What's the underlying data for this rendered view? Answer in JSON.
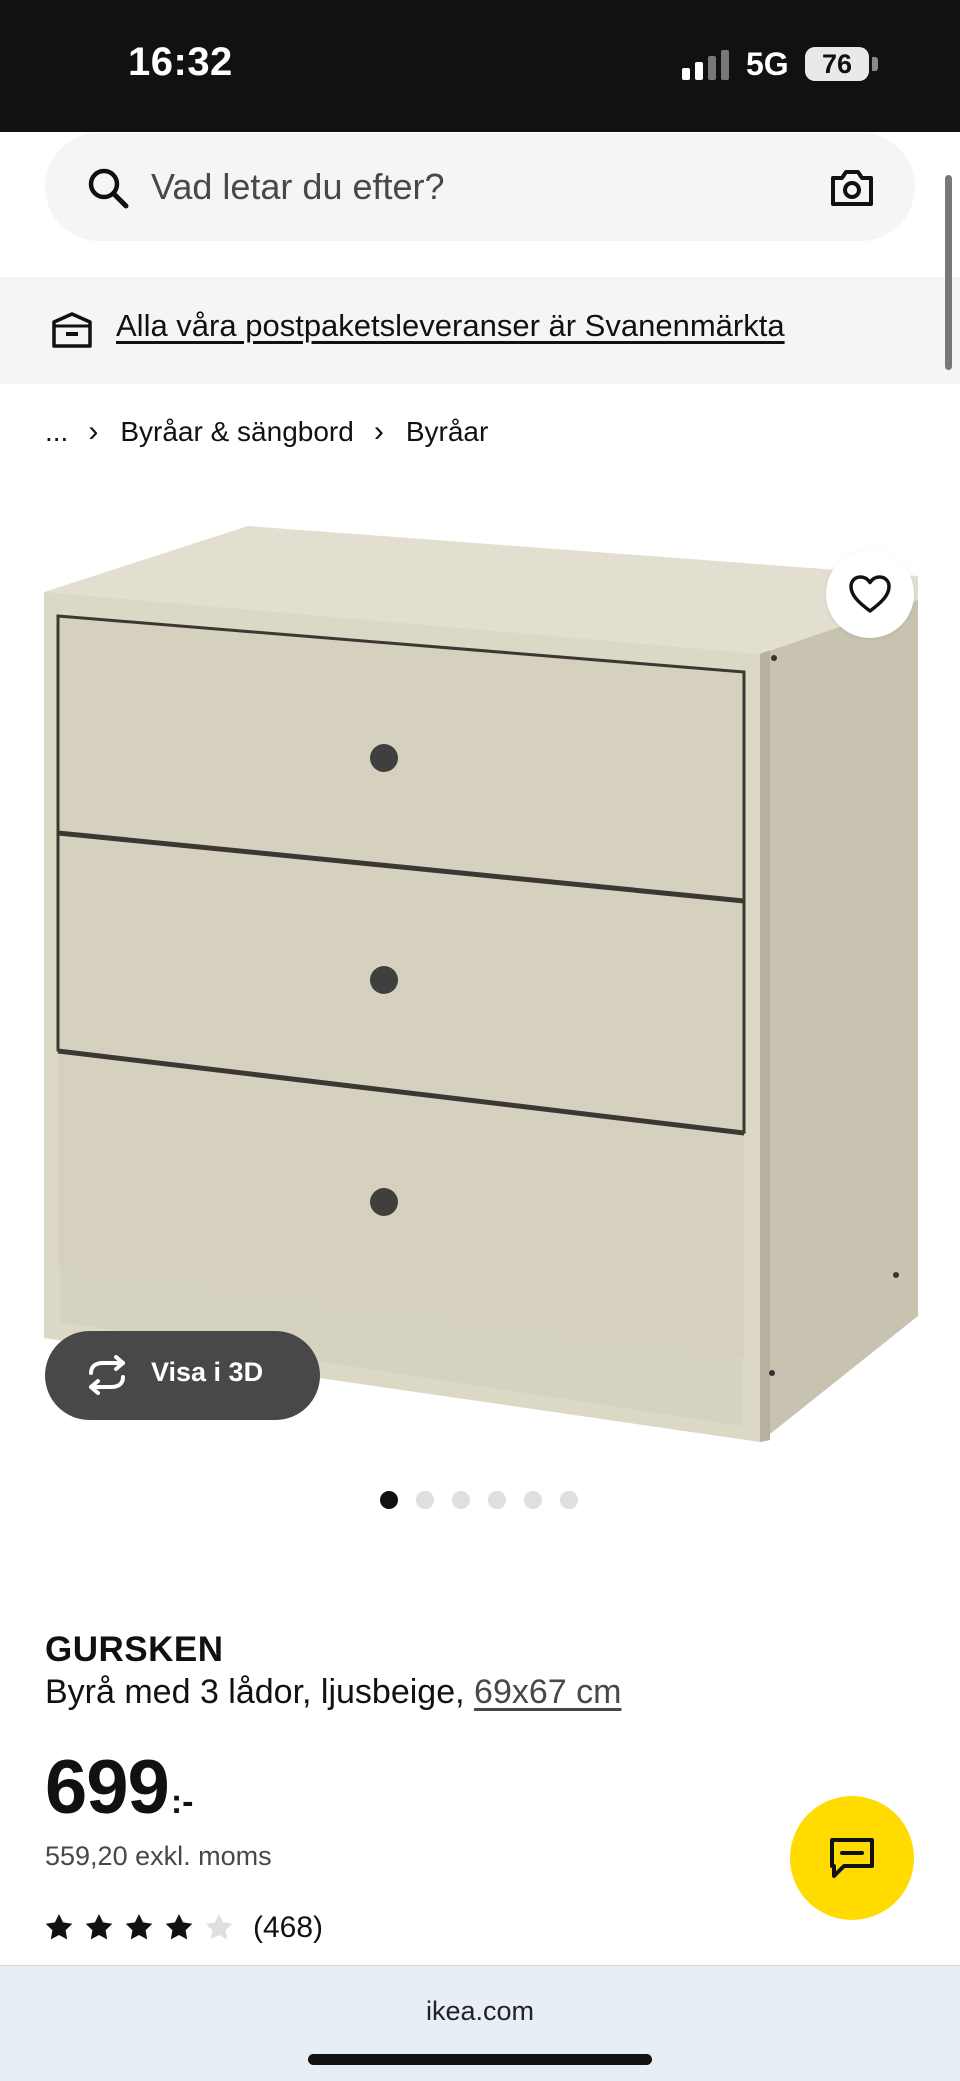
{
  "status_bar": {
    "time": "16:32",
    "network": "5G",
    "battery": "76"
  },
  "search": {
    "placeholder": "Vad letar du efter?",
    "search_icon": "search-icon",
    "camera_icon": "camera-icon"
  },
  "banner": {
    "text": "Alla våra postpaketsleveranser är Svanenmärkta",
    "icon": "box-icon"
  },
  "breadcrumb": {
    "items": [
      "...",
      "Byråar & sängbord",
      "Byråar"
    ]
  },
  "product": {
    "image_actions": {
      "favorite_icon": "heart-icon",
      "view_3d_label": "Visa i 3D",
      "view_3d_icon": "rotate-icon"
    },
    "carousel": {
      "count": 6,
      "active_index": 0
    },
    "name": "GURSKEN",
    "description": "Byrå med 3 lådor, ljusbeige,",
    "dimensions": "69x67 cm",
    "price": {
      "integer": "699",
      "suffix": ":-",
      "excl_vat": "559,20 exkl. moms"
    },
    "rating": {
      "stars": 4.5,
      "max": 5,
      "count": "(468)"
    }
  },
  "chat": {
    "icon": "chat-icon"
  },
  "browser": {
    "url": "ikea.com"
  },
  "colors": {
    "brand_yellow": "#ffdb00",
    "dark_button": "#484848",
    "banner_bg": "#f5f5f5"
  }
}
